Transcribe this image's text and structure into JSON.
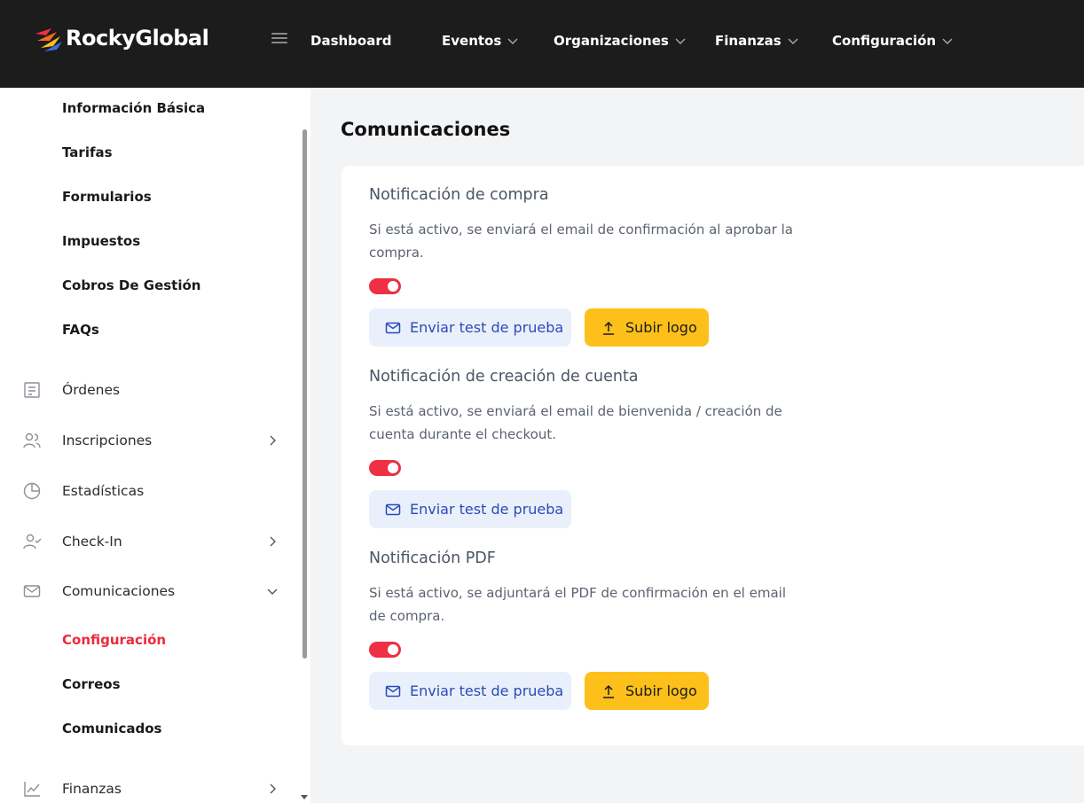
{
  "brand": {
    "name": "RockyGlobal"
  },
  "topnav": {
    "items": [
      {
        "label": "Dashboard",
        "has_dropdown": false
      },
      {
        "label": "Eventos",
        "has_dropdown": true
      },
      {
        "label": "Organizaciones",
        "has_dropdown": true
      },
      {
        "label": "Finanzas",
        "has_dropdown": true
      },
      {
        "label": "Configuración",
        "has_dropdown": true
      }
    ]
  },
  "sidebar": {
    "sub_items_top": [
      {
        "label": "Información Básica"
      },
      {
        "label": "Tarifas"
      },
      {
        "label": "Formularios"
      },
      {
        "label": "Impuestos"
      },
      {
        "label": "Cobros De Gestión"
      },
      {
        "label": "FAQs"
      }
    ],
    "items": [
      {
        "label": "Órdenes",
        "icon": "receipt-icon",
        "arrow": "none"
      },
      {
        "label": "Inscripciones",
        "icon": "users-icon",
        "arrow": "right"
      },
      {
        "label": "Estadísticas",
        "icon": "pie-chart-icon",
        "arrow": "none"
      },
      {
        "label": "Check-In",
        "icon": "user-check-icon",
        "arrow": "right"
      },
      {
        "label": "Comunicaciones",
        "icon": "mail-icon",
        "arrow": "down"
      },
      {
        "label": "Finanzas",
        "icon": "chart-line-icon",
        "arrow": "right"
      }
    ],
    "comunicaciones_sub": [
      {
        "label": "Configuración",
        "active": true
      },
      {
        "label": "Correos",
        "active": false
      },
      {
        "label": "Comunicados",
        "active": false
      }
    ]
  },
  "main": {
    "title": "Comunicaciones",
    "sections": [
      {
        "title": "Notificación de compra",
        "description": "Si está activo, se enviará el email de confirmación al aprobar la compra.",
        "enabled": true,
        "test_button": "Enviar test de prueba",
        "logo_button": "Subir logo"
      },
      {
        "title": "Notificación de creación de cuenta",
        "description": "Si está activo, se enviará el email de bienvenida / creación de cuenta durante el checkout.",
        "enabled": true,
        "test_button": "Enviar test de prueba"
      },
      {
        "title": "Notificación PDF",
        "description": "Si está activo, se adjuntará el PDF de confirmación en el email de compra.",
        "enabled": true,
        "test_button": "Enviar test de prueba",
        "logo_button": "Subir logo"
      }
    ]
  },
  "colors": {
    "topbar": "#1c1c1c",
    "accent_red": "#ea2a3c",
    "toggle_on": "#ef2f43",
    "button_yellow": "#fdc01a",
    "button_blue_bg": "#eaf0fb",
    "button_blue_text": "#2a4bb8"
  }
}
